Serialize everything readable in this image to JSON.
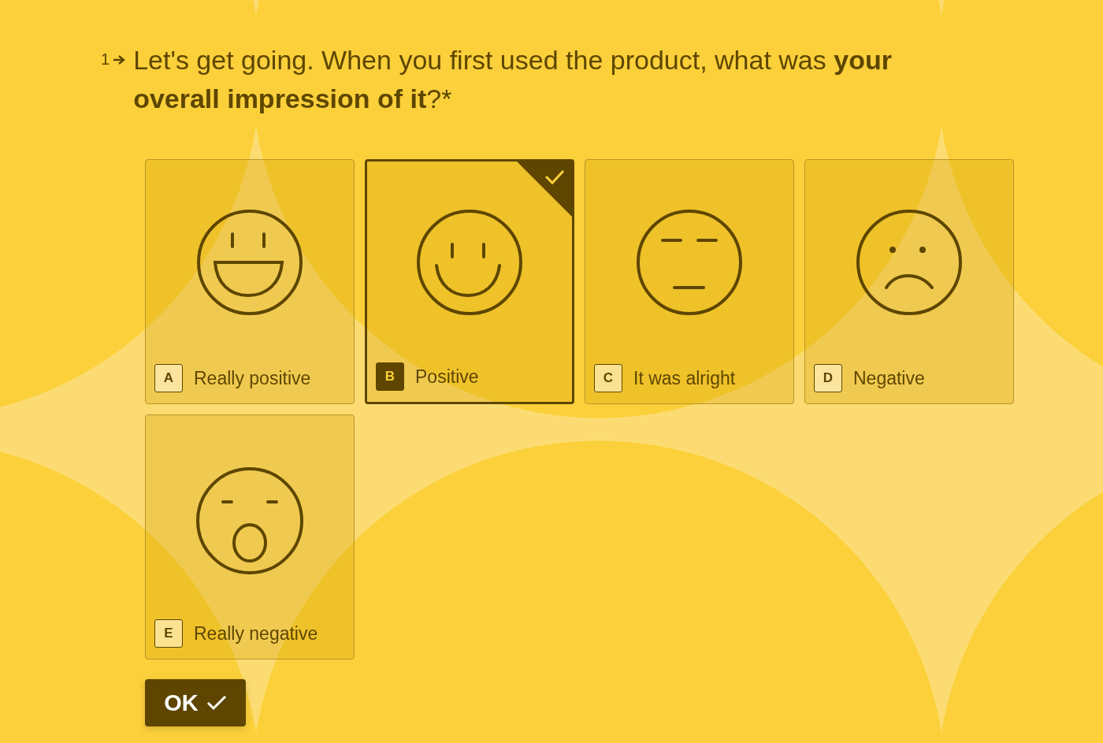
{
  "question": {
    "number": "1",
    "text": "Let's get going. When you first used the product, what was **your overall impression of it**?",
    "required_mark": "*"
  },
  "options": [
    {
      "key": "A",
      "label": "Really positive",
      "kind": "laughing",
      "selected": false
    },
    {
      "key": "B",
      "label": "Positive",
      "kind": "smile",
      "selected": true
    },
    {
      "key": "C",
      "label": "It was alright",
      "kind": "neutral",
      "selected": false
    },
    {
      "key": "D",
      "label": "Negative",
      "kind": "sad",
      "selected": false
    },
    {
      "key": "E",
      "label": "Really negative",
      "kind": "shocked",
      "selected": false
    }
  ],
  "submit": {
    "label": "OK"
  }
}
